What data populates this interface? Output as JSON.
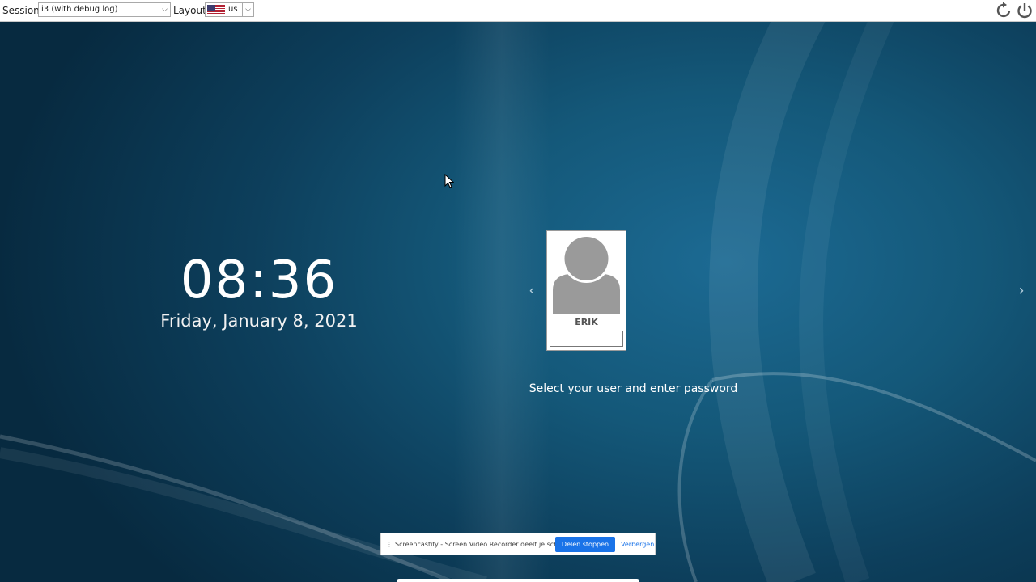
{
  "topbar": {
    "session_label": "Session",
    "session_value": "i3 (with debug log)",
    "layout_label": "Layout",
    "layout_value": "us",
    "layout_flag_icon": "us-flag-icon",
    "restart_icon": "restart-icon",
    "power_icon": "power-icon"
  },
  "clock": {
    "time": "08:36",
    "date": "Friday, January 8, 2021"
  },
  "login": {
    "username": "ERIK",
    "password_value": "",
    "prompt": "Select your user and enter password",
    "prev_icon": "chevron-left-icon",
    "next_icon": "chevron-right-icon",
    "prev_glyph": "‹",
    "next_glyph": "›"
  },
  "share_bar": {
    "message": "Screencastify - Screen Video Recorder deelt je scherm.",
    "stop_label": "Delen stoppen",
    "hide_label": "Verbergen"
  },
  "colors": {
    "accent": "#1a73e8",
    "background_dark": "#072a40",
    "background_light": "#1c6a93"
  }
}
